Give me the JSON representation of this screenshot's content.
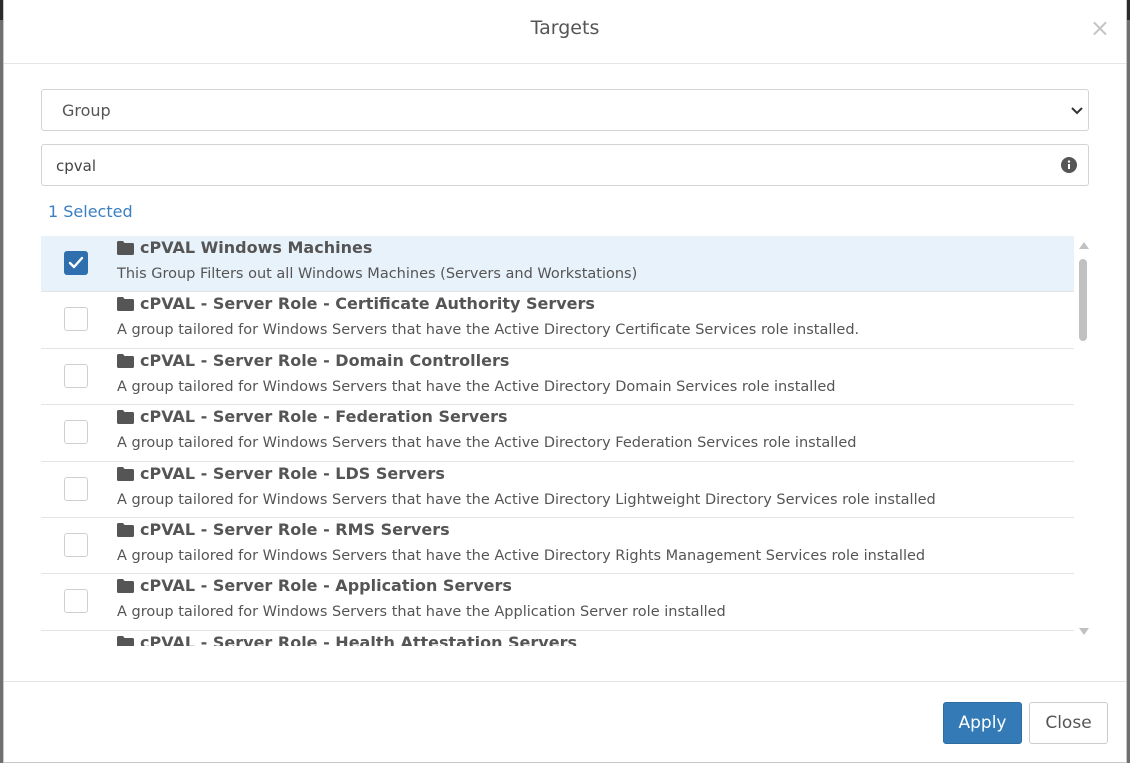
{
  "dialog": {
    "title": "Targets",
    "close_glyph": "×"
  },
  "filter": {
    "type_selected": "Group",
    "search_value": "cpval",
    "selected_count_label": "1 Selected"
  },
  "groups": [
    {
      "title": "cPVAL Windows Machines",
      "description": "This Group Filters out all Windows Machines (Servers and Workstations)",
      "checked": true
    },
    {
      "title": "cPVAL - Server Role - Certificate Authority Servers",
      "description": "A group tailored for Windows Servers that have the Active Directory Certificate Services role installed.",
      "checked": false
    },
    {
      "title": "cPVAL - Server Role - Domain Controllers",
      "description": "A group tailored for Windows Servers that have the Active Directory Domain Services role installed",
      "checked": false
    },
    {
      "title": "cPVAL - Server Role - Federation Servers",
      "description": "A group tailored for Windows Servers that have the Active Directory Federation Services role installed",
      "checked": false
    },
    {
      "title": "cPVAL - Server Role - LDS Servers",
      "description": "A group tailored for Windows Servers that have the Active Directory Lightweight Directory Services role installed",
      "checked": false
    },
    {
      "title": "cPVAL - Server Role - RMS Servers",
      "description": "A group tailored for Windows Servers that have the Active Directory Rights Management Services role installed",
      "checked": false
    },
    {
      "title": "cPVAL - Server Role - Application Servers",
      "description": "A group tailored for Windows Servers that have the Application Server role installed",
      "checked": false
    },
    {
      "title": "cPVAL - Server Role - Health Attestation Servers",
      "description": "",
      "checked": false
    }
  ],
  "footer": {
    "apply_label": "Apply",
    "close_label": "Close"
  },
  "colors": {
    "accent": "#337ab7",
    "selected_row": "#e8f2fb",
    "link_text": "#3a7fc1"
  }
}
